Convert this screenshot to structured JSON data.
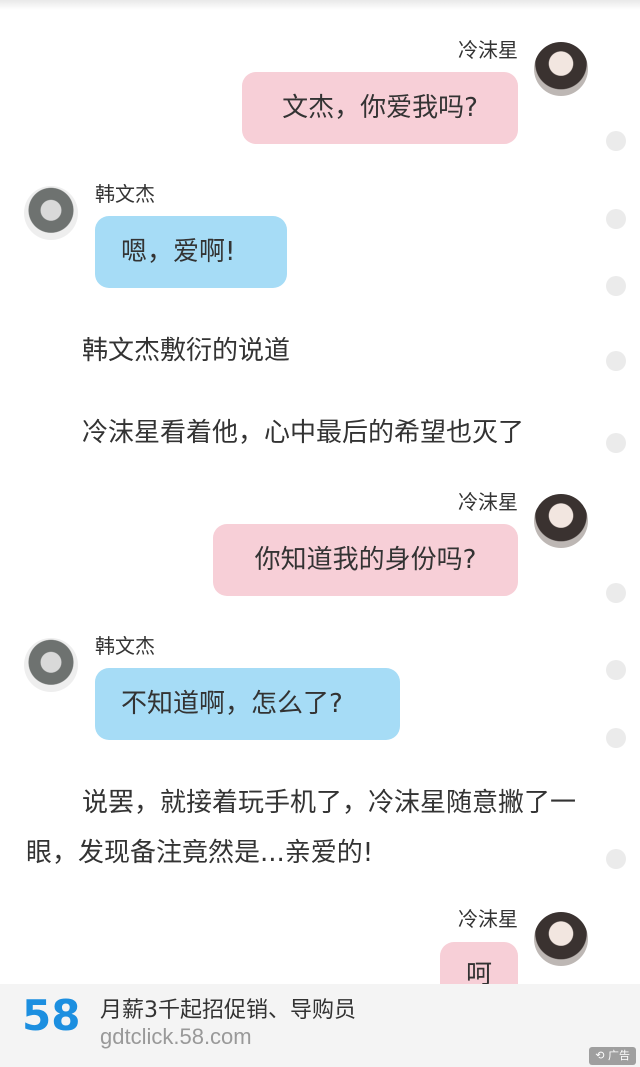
{
  "messages": [
    {
      "sender": "冷沫星",
      "text": "文杰，你爱我吗?"
    },
    {
      "sender": "韩文杰",
      "text": "嗯，爱啊!"
    },
    {
      "sender": "冷沫星",
      "text": "你知道我的身份吗?"
    },
    {
      "sender": "韩文杰",
      "text": "不知道啊，怎么了?"
    },
    {
      "sender": "冷沫星",
      "text": "呵"
    }
  ],
  "narration": [
    "韩文杰敷衍的说道",
    "冷沫星看着他，心中最后的希望也灭了",
    "说罢，就接着玩手机了，冷沫星随意撇了一眼，发现备注竟然是...亲爱的!"
  ],
  "ad": {
    "logo_text": "58",
    "title": "月薪3千起招促销、导购员",
    "url": "gdtclick.58.com",
    "badge": "广告"
  },
  "colors": {
    "pink_bubble": "#f7cfd7",
    "blue_bubble": "#a6dcf6",
    "logo_blue": "#1c8fe0",
    "logo_orange": "#f5821f"
  }
}
